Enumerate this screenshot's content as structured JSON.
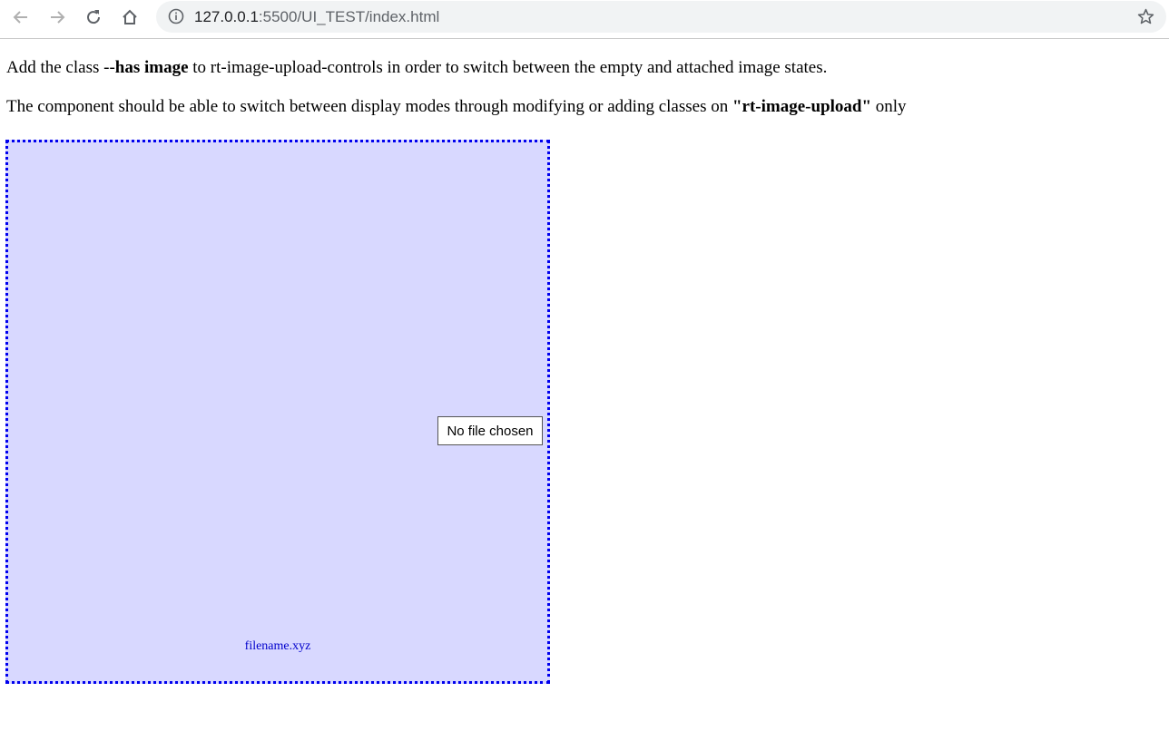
{
  "browser": {
    "url_host": "127.0.0.1",
    "url_path": ":5500/UI_TEST/index.html",
    "icons": {
      "back": "arrow-left-icon",
      "forward": "arrow-right-icon",
      "reload": "reload-icon",
      "home": "home-icon",
      "info": "info-icon",
      "bookmark": "star-icon"
    }
  },
  "page": {
    "p1": {
      "before": "Add the class --",
      "bold": "has image",
      "after": " to rt-image-upload-controls in order to switch between the empty and attached image states."
    },
    "p2": {
      "before": "The component should be able to switch between display modes through modifying or adding classes on ",
      "bold": "\"rt-image-upload\"",
      "after": " only"
    }
  },
  "uploader": {
    "file_button_label": "No file chosen",
    "filename": "filename.xyz",
    "colors": {
      "background": "#d8d8ff",
      "border": "#0000ee",
      "filename_text": "#0000cc"
    }
  }
}
